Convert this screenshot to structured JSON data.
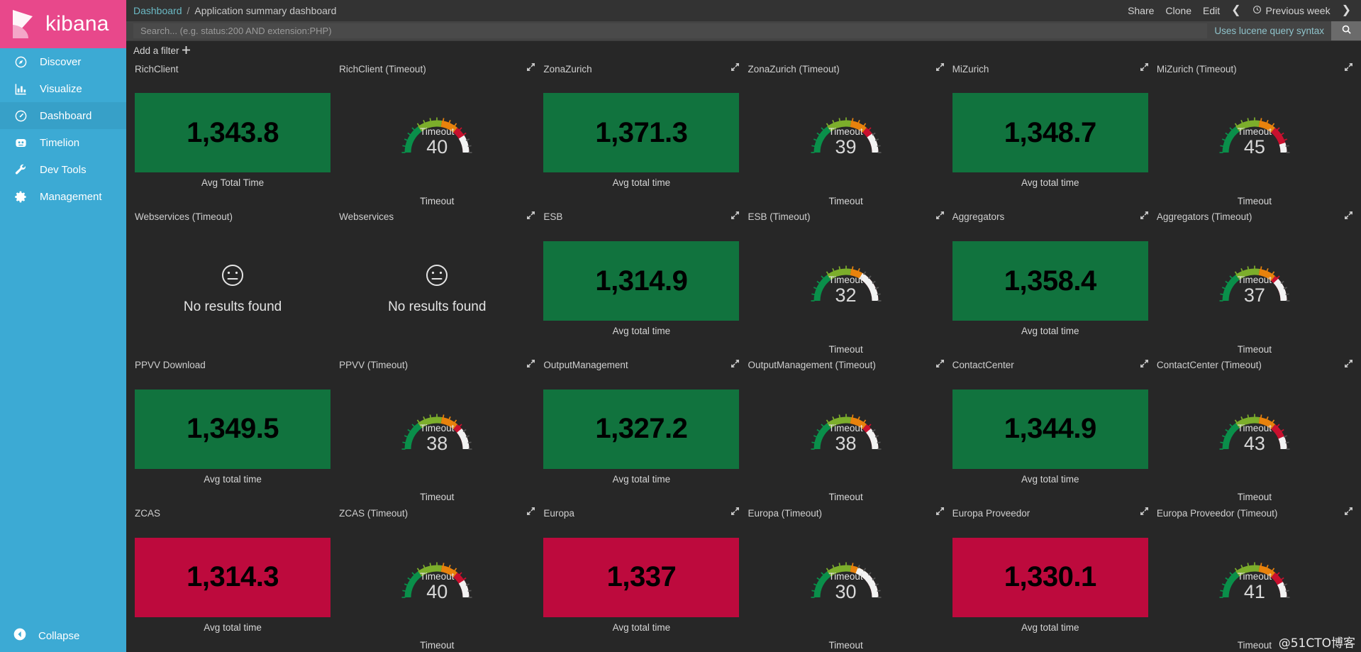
{
  "brand": {
    "name": "kibana",
    "logo_icon": "kibana-logo-icon"
  },
  "sidebar": {
    "items": [
      {
        "label": "Discover",
        "icon": "compass-icon",
        "active": false
      },
      {
        "label": "Visualize",
        "icon": "bar-chart-icon",
        "active": false
      },
      {
        "label": "Dashboard",
        "icon": "gauge-icon",
        "active": true
      },
      {
        "label": "Timelion",
        "icon": "timelion-icon",
        "active": false
      },
      {
        "label": "Dev Tools",
        "icon": "wrench-icon",
        "active": false
      },
      {
        "label": "Management",
        "icon": "gear-icon",
        "active": false
      }
    ],
    "collapse": {
      "label": "Collapse",
      "icon": "chevron-left-circle-icon"
    }
  },
  "topbar": {
    "breadcrumb": [
      "Dashboard",
      "Application summary dashboard"
    ],
    "separator": "/",
    "share_label": "Share",
    "clone_label": "Clone",
    "edit_label": "Edit",
    "prev_arrow": "❮",
    "next_arrow": "❯",
    "time_range": "Previous week",
    "time_icon": "clock-icon"
  },
  "querybar": {
    "placeholder": "Search... (e.g. status:200 AND extension:PHP)",
    "value": "",
    "hint": "Uses lucene query syntax",
    "search_icon": "search-icon"
  },
  "filterbar": {
    "add_filter_label": "Add a filter",
    "plus_icon": "plus-icon"
  },
  "colors": {
    "green": "#11733e",
    "red": "#bd0a3d",
    "sidebar": "#3caad4",
    "sidebar_active": "#37a0c8",
    "brand_pink": "#e8488b",
    "background": "#272727",
    "topbar": "#333333",
    "querybar": "#444444",
    "gauge_green": "#0a8f4a",
    "gauge_orange": "#e8820c",
    "gauge_red": "#c8102e",
    "gauge_track": "#f2f2f2"
  },
  "watermark": "@51CTO博客",
  "expand_icon": "expand-arrows-icon",
  "no_results": {
    "text": "No results found",
    "icon": "neutral-face-icon"
  },
  "panels": [
    {
      "title": "RichClient",
      "type": "metric",
      "value": "1,343.8",
      "label": "Avg Total Time",
      "color": "#11733e",
      "expandable": false
    },
    {
      "title": "RichClient (Timeout)",
      "type": "gauge",
      "value": "40",
      "gauge_title": "Timeout",
      "label": "Timeout",
      "pct": 0.82,
      "expandable": true
    },
    {
      "title": "ZonaZurich",
      "type": "metric",
      "value": "1,371.3",
      "label": "Avg total time",
      "color": "#11733e",
      "expandable": true
    },
    {
      "title": "ZonaZurich (Timeout)",
      "type": "gauge",
      "value": "39",
      "gauge_title": "Timeout",
      "label": "Timeout",
      "pct": 0.8,
      "expandable": true
    },
    {
      "title": "MiZurich",
      "type": "metric",
      "value": "1,348.7",
      "label": "Avg total time",
      "color": "#11733e",
      "expandable": true
    },
    {
      "title": "MiZurich (Timeout)",
      "type": "gauge",
      "value": "45",
      "gauge_title": "Timeout",
      "label": "Timeout",
      "pct": 0.9,
      "expandable": true
    },
    {
      "title": "Webservices (Timeout)",
      "type": "noresults",
      "expandable": false
    },
    {
      "title": "Webservices",
      "type": "noresults",
      "expandable": true
    },
    {
      "title": "ESB",
      "type": "metric",
      "value": "1,314.9",
      "label": "Avg total time",
      "color": "#11733e",
      "expandable": true
    },
    {
      "title": "ESB (Timeout)",
      "type": "gauge",
      "value": "32",
      "gauge_title": "Timeout",
      "label": "Timeout",
      "pct": 0.67,
      "expandable": true
    },
    {
      "title": "Aggregators",
      "type": "metric",
      "value": "1,358.4",
      "label": "Avg total time",
      "color": "#11733e",
      "expandable": true
    },
    {
      "title": "Aggregators (Timeout)",
      "type": "gauge",
      "value": "37",
      "gauge_title": "Timeout",
      "label": "Timeout",
      "pct": 0.76,
      "expandable": true
    },
    {
      "title": "PPVV Download",
      "type": "metric",
      "value": "1,349.5",
      "label": "Avg total time",
      "color": "#11733e",
      "expandable": false
    },
    {
      "title": "PPVV (Timeout)",
      "type": "gauge",
      "value": "38",
      "gauge_title": "Timeout",
      "label": "Timeout",
      "pct": 0.78,
      "expandable": true
    },
    {
      "title": "OutputManagement",
      "type": "metric",
      "value": "1,327.2",
      "label": "Avg total time",
      "color": "#11733e",
      "expandable": true
    },
    {
      "title": "OutputManagement (Timeout)",
      "type": "gauge",
      "value": "38",
      "gauge_title": "Timeout",
      "label": "Timeout",
      "pct": 0.78,
      "expandable": true
    },
    {
      "title": "ContactCenter",
      "type": "metric",
      "value": "1,344.9",
      "label": "Avg total time",
      "color": "#11733e",
      "expandable": true
    },
    {
      "title": "ContactCenter (Timeout)",
      "type": "gauge",
      "value": "43",
      "gauge_title": "Timeout",
      "label": "Timeout",
      "pct": 0.87,
      "expandable": true
    },
    {
      "title": "ZCAS",
      "type": "metric",
      "value": "1,314.3",
      "label": "Avg total time",
      "color": "#bd0a3d",
      "expandable": false
    },
    {
      "title": "ZCAS (Timeout)",
      "type": "gauge",
      "value": "40",
      "gauge_title": "Timeout",
      "label": "Timeout",
      "pct": 0.82,
      "expandable": true
    },
    {
      "title": "Europa",
      "type": "metric",
      "value": "1,337",
      "label": "Avg total time",
      "color": "#bd0a3d",
      "expandable": true
    },
    {
      "title": "Europa (Timeout)",
      "type": "gauge",
      "value": "30",
      "gauge_title": "Timeout",
      "label": "Timeout",
      "pct": 0.62,
      "expandable": true
    },
    {
      "title": "Europa Proveedor",
      "type": "metric",
      "value": "1,330.1",
      "label": "Avg total time",
      "color": "#bd0a3d",
      "expandable": true
    },
    {
      "title": "Europa Proveedor (Timeout)",
      "type": "gauge",
      "value": "41",
      "gauge_title": "Timeout",
      "label": "Timeout",
      "pct": 0.84,
      "expandable": true
    }
  ]
}
